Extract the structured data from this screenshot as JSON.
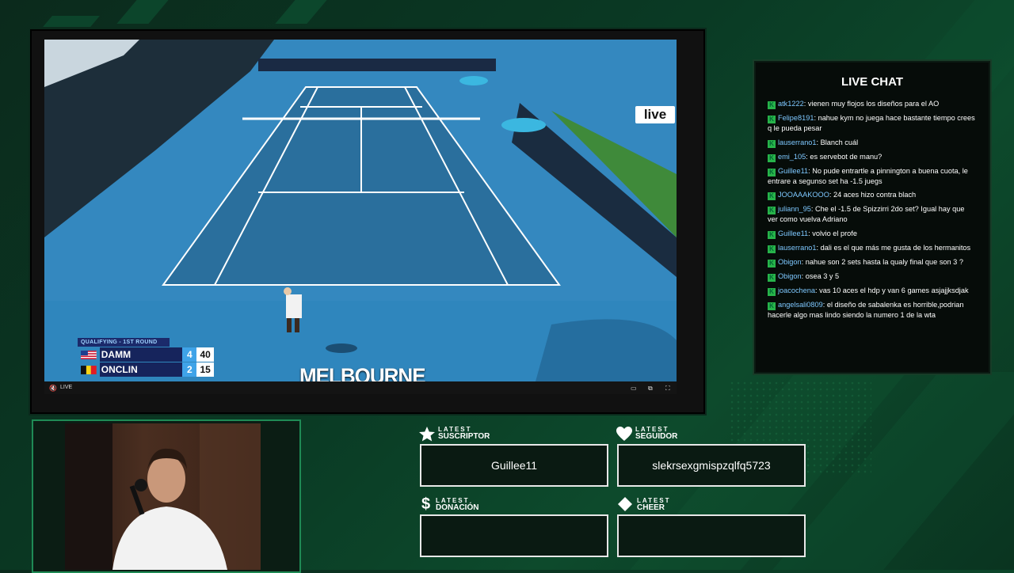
{
  "scoreboard": {
    "round": "QUALIFYING - 1ST ROUND",
    "players": [
      {
        "name": "DAMM",
        "sets": "4",
        "points": "40",
        "serving": true
      },
      {
        "name": "ONCLIN",
        "sets": "2",
        "points": "15",
        "serving": false
      }
    ]
  },
  "video": {
    "branding": "MELBOURNE",
    "broadcaster": "live",
    "live_label": "LIVE"
  },
  "chat": {
    "title": "LIVE CHAT",
    "messages": [
      {
        "user": "atk1222",
        "text": "vienen muy flojos los diseños para el AO"
      },
      {
        "user": "Felipe8191",
        "text": "nahue kym no juega hace bastante tiempo crees q le pueda pesar"
      },
      {
        "user": "lauserrano1",
        "text": "Blanch cuál"
      },
      {
        "user": "emi_105",
        "text": "es servebot de manu?"
      },
      {
        "user": "Guillee11",
        "text": "No pude entrartle a pinnington a buena cuota, le entrare a segunso set ha -1.5 juegs"
      },
      {
        "user": "JOOAAAKOOO",
        "text": "24 aces hizo contra blach"
      },
      {
        "user": "juliann_95",
        "text": "Che el -1.5 de Spizzirri 2do set? Igual hay que ver como vuelva Adriano"
      },
      {
        "user": "Guillee11",
        "text": "volvio el profe"
      },
      {
        "user": "lauserrano1",
        "text": "dali es el que más me gusta de los hermanitos"
      },
      {
        "user": "Obigon",
        "text": "nahue son 2 sets hasta la qualy final que son 3 ?"
      },
      {
        "user": "Obigon",
        "text": "osea 3 y 5"
      },
      {
        "user": "joacochena",
        "text": "vas 10 aces el hdp y van 6 games asjajjksdjak"
      },
      {
        "user": "angelsali0809",
        "text": "el diseño de sabalenka es horrible,podrian hacerle algo mas lindo siendo la numero 1 de la wta"
      }
    ]
  },
  "widgets": {
    "subscriber": {
      "small": "LATEST",
      "big": "SUSCRIPTOR",
      "value": "Guillee11",
      "icon": "star-icon"
    },
    "follower": {
      "small": "LATEST",
      "big": "SEGUIDOR",
      "value": "slekrsexgmispzqlfq5723",
      "icon": "heart-icon"
    },
    "donation": {
      "small": "LATEST",
      "big": "DONACIÓN",
      "value": "",
      "icon": "dollar-icon"
    },
    "cheer": {
      "small": "LATEST",
      "big": "CHEER",
      "value": "",
      "icon": "diamond-icon"
    }
  },
  "colors": {
    "accent": "#1f8a55",
    "court": "#2f7fb3",
    "chat_user": "#7ec8ff",
    "badge": "#27b34a"
  }
}
